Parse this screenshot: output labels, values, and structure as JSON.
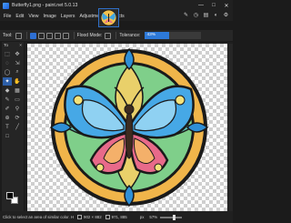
{
  "window": {
    "title": "Butterfly1.png - paint.net 5.0.13",
    "controls": [
      "—",
      "□",
      "✕"
    ]
  },
  "menu": {
    "items": [
      "File",
      "Edit",
      "View",
      "Image",
      "Layers",
      "Adjustments",
      "Effects"
    ]
  },
  "toolbar": {
    "tool_label": "Tool:",
    "flood_mode_label": "Flood Mode:",
    "tolerance_label": "Tolerance:",
    "tolerance_value": "43%",
    "tolerance_fraction": 0.43
  },
  "tools": {
    "header": "To",
    "close": "×"
  },
  "status": {
    "hint": "Click to select an area of similar color. Hold Shift for Global...",
    "image_size": "902 × 882",
    "cursor": "971, 885",
    "units": "px",
    "zoom": "57%",
    "zoom_fraction": 0.57
  },
  "colors": {
    "accent": "#2d79d8",
    "bg": "#1b1b1b"
  }
}
